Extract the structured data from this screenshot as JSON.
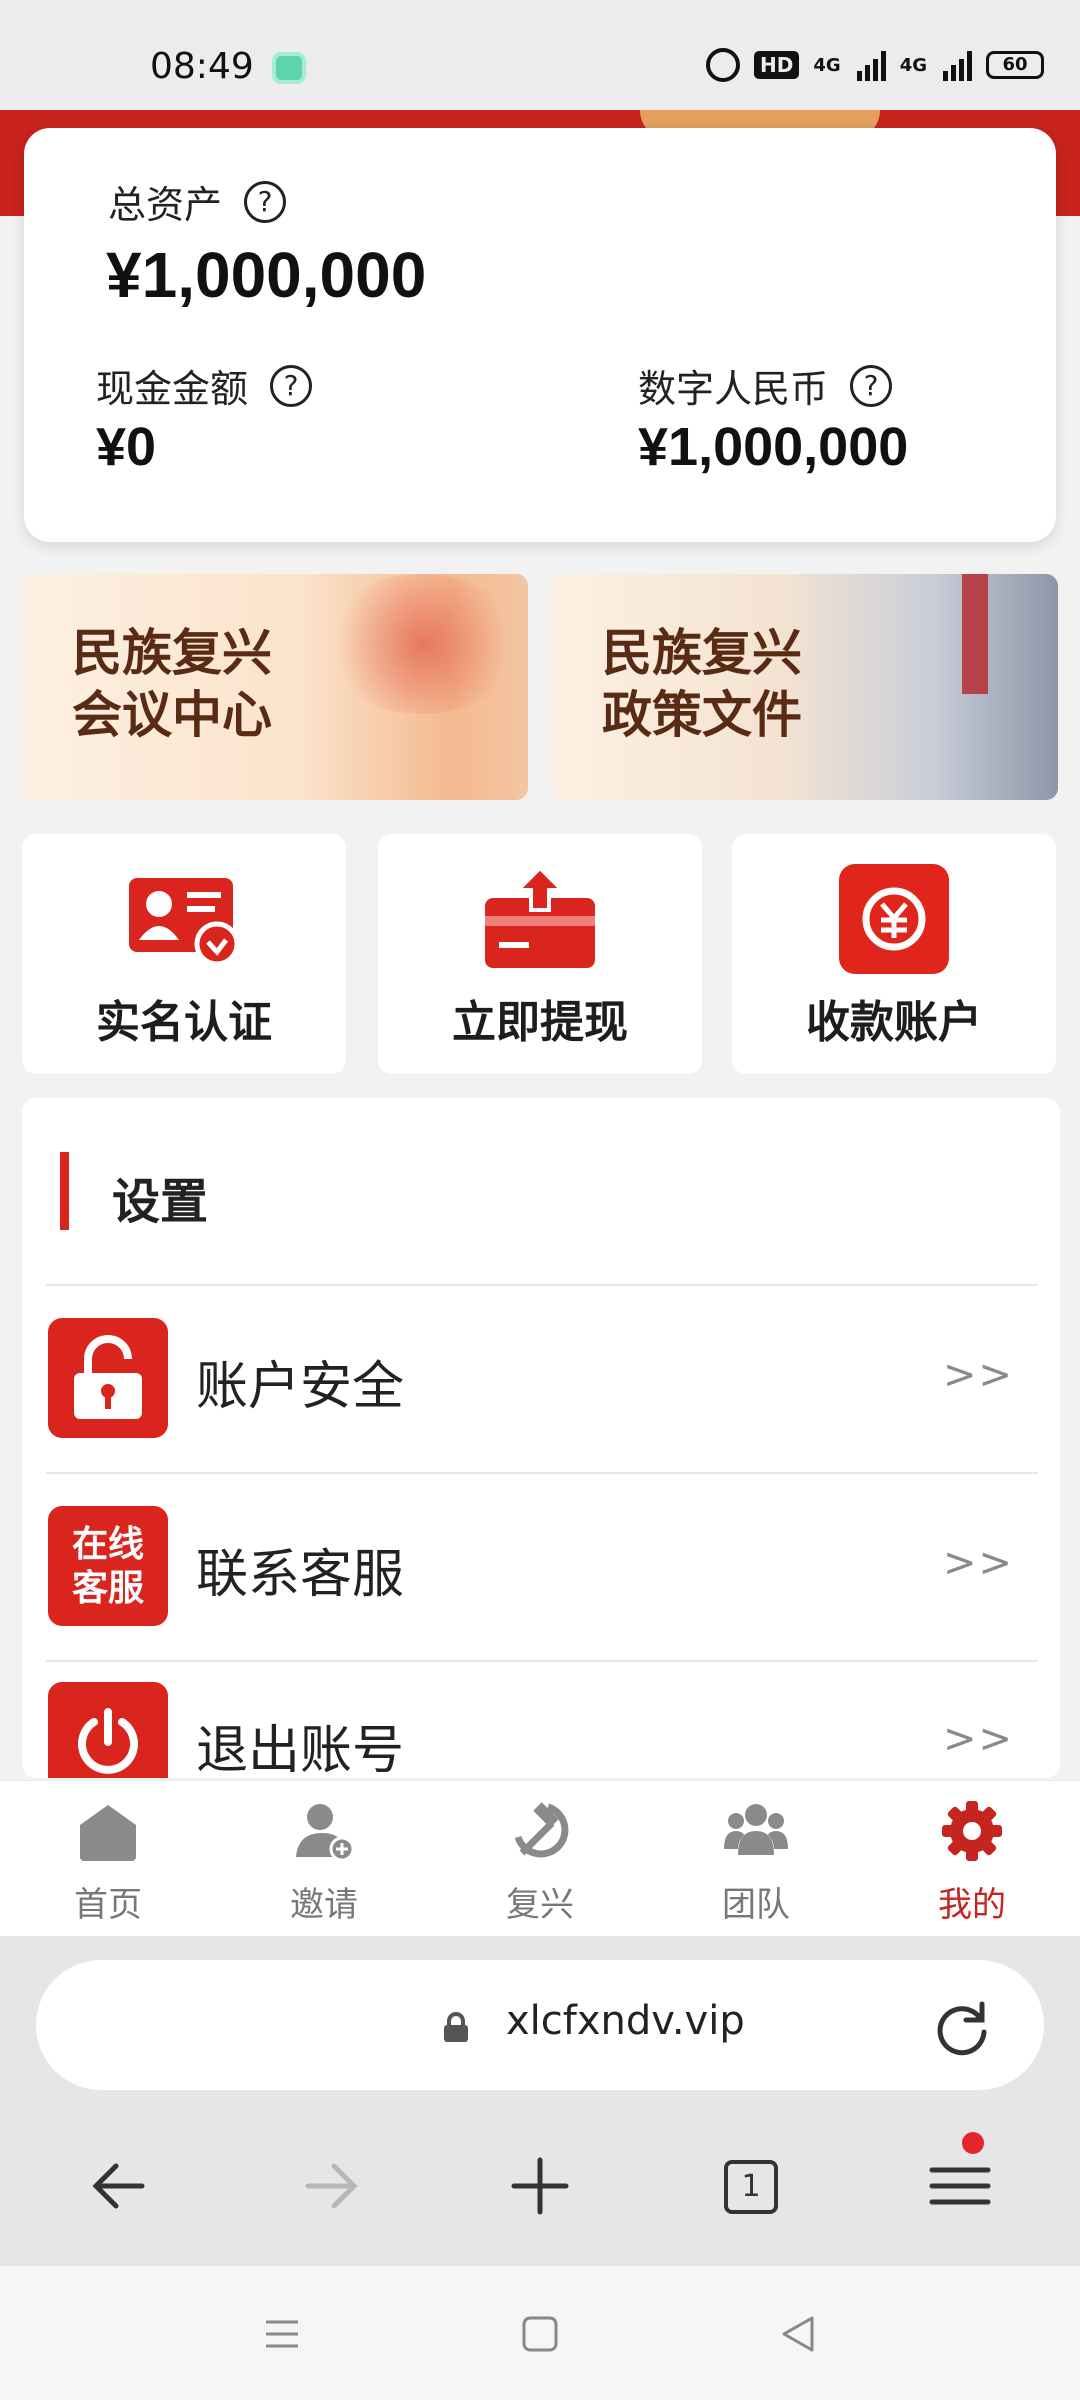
{
  "status_bar": {
    "time": "08:49",
    "battery": "60",
    "network_1": "4G",
    "network_2": "4G",
    "hd": "HD"
  },
  "assets": {
    "total_label": "总资产",
    "total_value": "¥1,000,000",
    "cash_label": "现金金额",
    "cash_value": "¥0",
    "digital_label": "数字人民币",
    "digital_value": "¥1,000,000",
    "help_symbol": "?"
  },
  "banners": [
    {
      "line1": "民族复兴",
      "line2": "会议中心"
    },
    {
      "line1": "民族复兴",
      "line2": "政策文件"
    }
  ],
  "tiles": [
    {
      "label": "实名认证",
      "icon": "id-card-verify-icon"
    },
    {
      "label": "立即提现",
      "icon": "card-withdraw-icon"
    },
    {
      "label": "收款账户",
      "icon": "yuan-exchange-icon"
    }
  ],
  "settings": {
    "title": "设置",
    "items": [
      {
        "label": "账户安全",
        "arrow": ">>",
        "icon": "unlock-icon"
      },
      {
        "label": "联系客服",
        "arrow": ">>",
        "icon": "online-service-icon",
        "icon_line1": "在线",
        "icon_line2": "客服"
      },
      {
        "label": "退出账号",
        "arrow": ">>",
        "icon": "power-icon"
      }
    ]
  },
  "tabbar": {
    "items": [
      {
        "label": "首页",
        "icon": "home-icon"
      },
      {
        "label": "邀请",
        "icon": "invite-user-icon"
      },
      {
        "label": "复兴",
        "icon": "hammer-sickle-icon"
      },
      {
        "label": "团队",
        "icon": "team-icon"
      },
      {
        "label": "我的",
        "icon": "gear-icon",
        "active": true
      }
    ]
  },
  "browser": {
    "url": "xlcfxndv.vip",
    "tab_count": "1"
  },
  "colors": {
    "brand_red": "#d9251d",
    "active_tab": "#c62420",
    "banner_text": "#5a2b14"
  }
}
